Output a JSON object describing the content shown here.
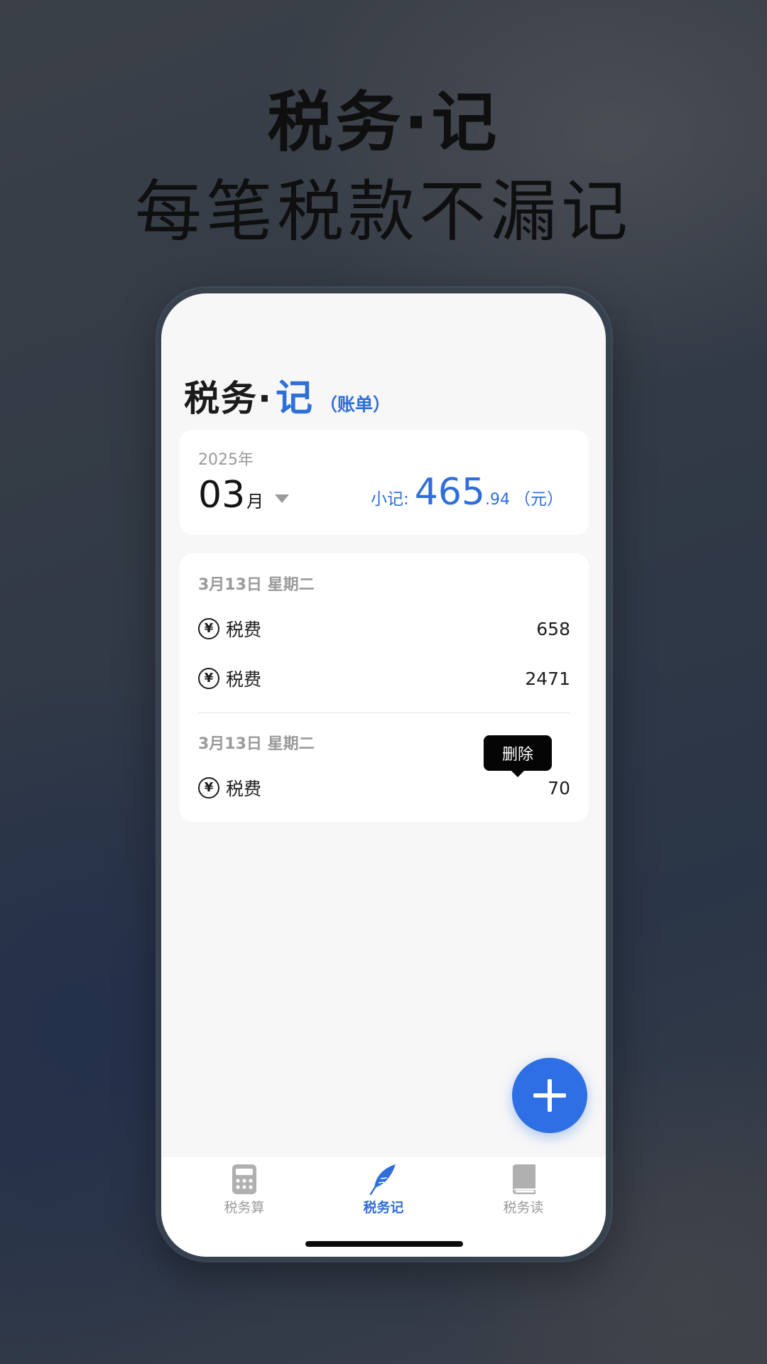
{
  "marketing": {
    "title": "税务·记",
    "subtitle": "每笔税款不漏记"
  },
  "header": {
    "title_main": "税务·",
    "title_accent": "记",
    "title_tag": "（账单）"
  },
  "summary": {
    "year": "2025年",
    "month": "03",
    "month_unit": "月",
    "subtotal_label": "小记:",
    "subtotal_int": "465",
    "subtotal_dec": ".94",
    "subtotal_unit": "（元）"
  },
  "groups": [
    {
      "date": "3月13日  星期二",
      "entries": [
        {
          "icon": "yuan-circle-icon",
          "label": "税费",
          "amount": "658"
        },
        {
          "icon": "yuan-circle-icon",
          "label": "税费",
          "amount": "2471"
        }
      ]
    },
    {
      "date": "3月13日  星期二",
      "entries": [
        {
          "icon": "yuan-circle-icon",
          "label": "税费",
          "amount": "70"
        }
      ]
    }
  ],
  "icon_glyph": "¥",
  "tooltip": {
    "label": "删除"
  },
  "tabs": [
    {
      "label": "税务算",
      "icon": "calculator-icon",
      "active": false
    },
    {
      "label": "税务记",
      "icon": "feather-icon",
      "active": true
    },
    {
      "label": "税务读",
      "icon": "book-icon",
      "active": false
    }
  ],
  "colors": {
    "accent": "#2f6fd9",
    "fab": "#2f6fe6",
    "muted": "#9a9a9a",
    "text": "#1e1e1e"
  }
}
